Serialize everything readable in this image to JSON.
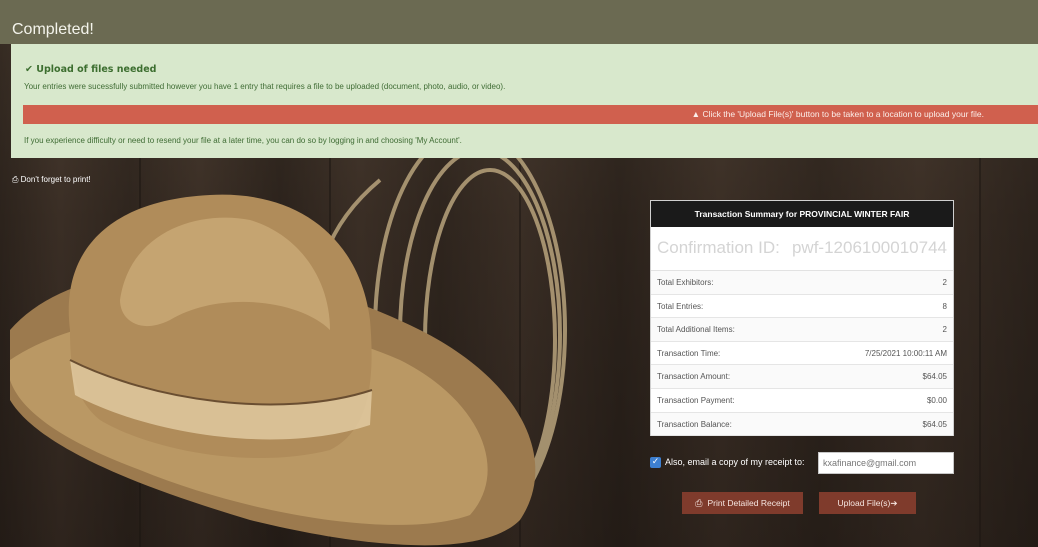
{
  "page": {
    "title": "Completed!"
  },
  "alert": {
    "title": "Upload of files needed",
    "message": "Your entries were sucessfully submitted however you have 1 entry that requires a file to be uploaded (document, photo, audio, or video).",
    "upload_notice": "Click the 'Upload File(s)' button to be taken to a location to upload your file.",
    "footer": "If you experience difficulty or need to resend your file at a later time, you can do so by logging in and choosing 'My Account'.",
    "icons": {
      "title_icon": "check-icon",
      "notice_icon": "warning-icon"
    }
  },
  "print_reminder": {
    "label": "Don't forget to print!",
    "icon": "printer-icon"
  },
  "summary": {
    "header": "Transaction Summary for PROVINCIAL WINTER FAIR",
    "confirmation_label": "Confirmation ID:",
    "confirmation_id": "pwf-1206100010744",
    "rows": [
      {
        "label": "Total Exhibitors:",
        "value": "2"
      },
      {
        "label": "Total Entries:",
        "value": "8"
      },
      {
        "label": "Total Additional Items:",
        "value": "2"
      },
      {
        "label": "Transaction Time:",
        "value": "7/25/2021 10:00:11 AM"
      },
      {
        "label": "Transaction Amount:",
        "value": "$64.05"
      },
      {
        "label": "Transaction Payment:",
        "value": "$0.00"
      },
      {
        "label": "Transaction Balance:",
        "value": "$64.05"
      }
    ]
  },
  "email_receipt": {
    "checked": true,
    "label": "Also, email a copy of my receipt to:",
    "value": "kxafinance@gmail.com"
  },
  "buttons": {
    "print_label": "Print Detailed Receipt",
    "upload_label": "Upload File(s)"
  },
  "colors": {
    "title_bar": "#6b6a52",
    "alert_background": "#d8e8cc",
    "upload_banner": "#d0604e",
    "button": "#7f3b2c"
  }
}
